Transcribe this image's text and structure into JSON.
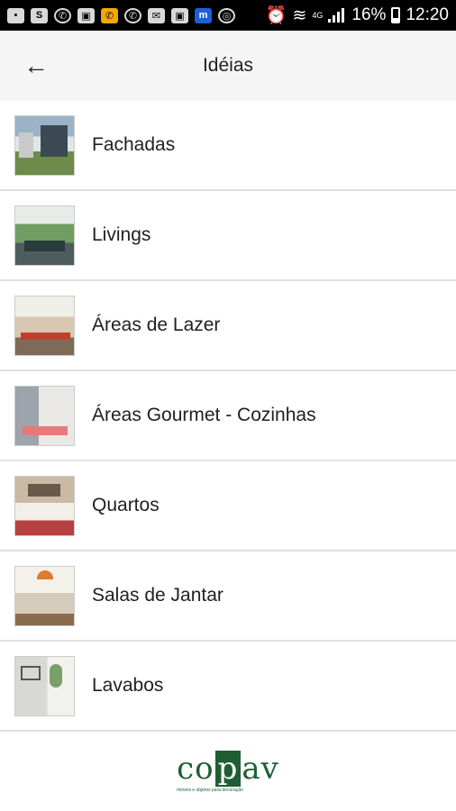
{
  "status_bar": {
    "battery": "16%",
    "time": "12:20",
    "network": "4G",
    "icons": [
      "chat-icon",
      "s-icon",
      "phone-icon",
      "image-icon",
      "missed-call-icon",
      "whatsapp-icon",
      "mail-icon",
      "photo-icon",
      "m-icon",
      "instagram-icon",
      "alarm-icon",
      "wifi-icon",
      "signal-icon",
      "battery-icon"
    ]
  },
  "app_bar": {
    "title": "Idéias",
    "back_icon": "arrow-left-icon"
  },
  "items": [
    {
      "label": "Fachadas"
    },
    {
      "label": "Livings"
    },
    {
      "label": "Áreas de Lazer"
    },
    {
      "label": "Áreas Gourmet - Cozinhas"
    },
    {
      "label": "Quartos"
    },
    {
      "label": "Salas de Jantar"
    },
    {
      "label": "Lavabos"
    }
  ],
  "footer": {
    "logo_prefix": "co",
    "logo_p": "p",
    "logo_suffix": "av",
    "logo_tagline": "móveis e objetos para decoração",
    "brand_color": "#1f5e34"
  }
}
